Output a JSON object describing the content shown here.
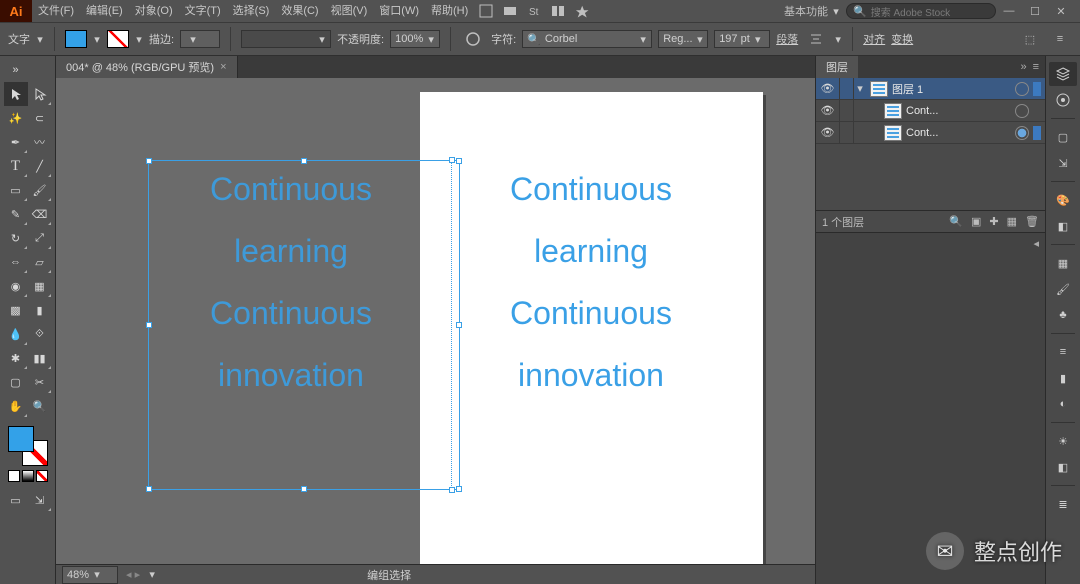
{
  "app": {
    "logo": "Ai"
  },
  "menus": [
    "文件(F)",
    "编辑(E)",
    "对象(O)",
    "文字(T)",
    "选择(S)",
    "效果(C)",
    "视图(V)",
    "窗口(W)",
    "帮助(H)"
  ],
  "workspace": {
    "name": "基本功能"
  },
  "stock_search": {
    "placeholder": "搜索 Adobe Stock"
  },
  "optbar": {
    "tool": "文字",
    "stroke_label": "描边:",
    "stroke_weight": "",
    "opacity_label": "不透明度:",
    "opacity_value": "100%",
    "char_label": "字符:",
    "font_family": "Corbel",
    "font_style": "Reg...",
    "font_size": "197 pt",
    "para_label": "段落",
    "align_label": "对齐",
    "transform_label": "变换"
  },
  "doc_tab": {
    "title": "004* @ 48% (RGB/GPU 预览)"
  },
  "canvas_text": {
    "line1": "Continuous",
    "line2": "learning",
    "line3": "Continuous",
    "line4": "innovation"
  },
  "layers": {
    "tab": "图层",
    "items": [
      {
        "name": "图层 1",
        "indent": 0,
        "twisty": "▾",
        "selected": true,
        "target": "ring"
      },
      {
        "name": "Cont...",
        "indent": 1,
        "twisty": "",
        "selected": false,
        "target": "ring"
      },
      {
        "name": "Cont...",
        "indent": 1,
        "twisty": "",
        "selected": false,
        "target": "filled"
      }
    ],
    "footer_count": "1 个图层"
  },
  "status": {
    "zoom": "48%",
    "hint": "编组选择"
  },
  "watermark": {
    "text": "整点创作"
  }
}
